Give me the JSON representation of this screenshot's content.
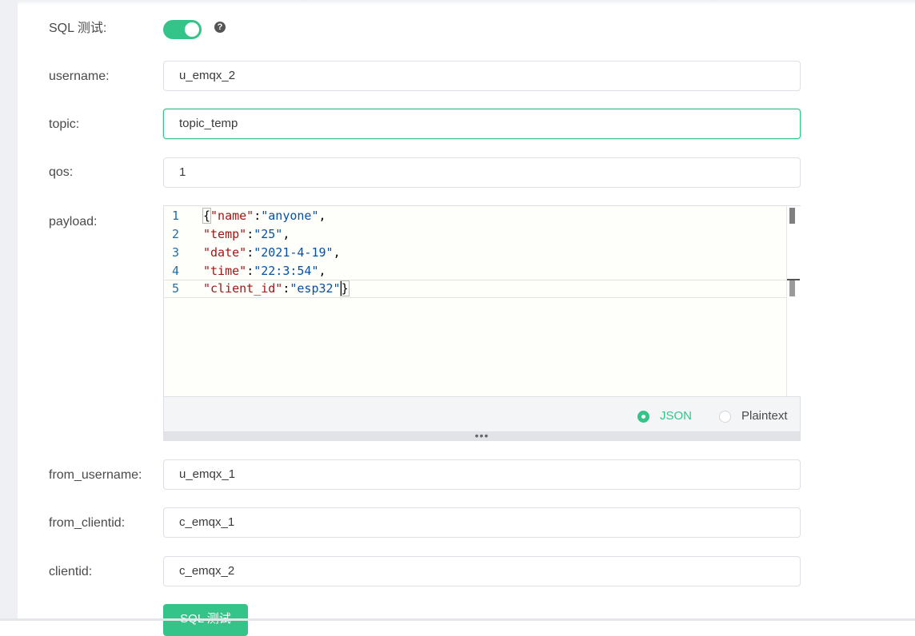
{
  "form": {
    "sql_test_label": "SQL 测试:",
    "sql_test_enabled": true,
    "help_icon": "question-circle-icon",
    "help_glyph": "?",
    "username": {
      "label": "username:",
      "value": "u_emqx_2"
    },
    "topic": {
      "label": "topic:",
      "value": "topic_temp"
    },
    "qos": {
      "label": "qos:",
      "value": "1"
    },
    "payload": {
      "label": "payload:",
      "line_numbers": [
        "1",
        "2",
        "3",
        "4",
        "5"
      ],
      "lines": [
        [
          {
            "t": "p",
            "v": "{"
          },
          {
            "t": "k",
            "v": "\"name\""
          },
          {
            "t": "p",
            "v": ":"
          },
          {
            "t": "s",
            "v": "\"anyone\""
          },
          {
            "t": "p",
            "v": ","
          }
        ],
        [
          {
            "t": "k",
            "v": "\"temp\""
          },
          {
            "t": "p",
            "v": ":"
          },
          {
            "t": "s",
            "v": "\"25\""
          },
          {
            "t": "p",
            "v": ","
          }
        ],
        [
          {
            "t": "k",
            "v": "\"date\""
          },
          {
            "t": "p",
            "v": ":"
          },
          {
            "t": "s",
            "v": "\"2021-4-19\""
          },
          {
            "t": "p",
            "v": ","
          }
        ],
        [
          {
            "t": "k",
            "v": "\"time\""
          },
          {
            "t": "p",
            "v": ":"
          },
          {
            "t": "s",
            "v": "\"22:3:54\""
          },
          {
            "t": "p",
            "v": ","
          }
        ],
        [
          {
            "t": "k",
            "v": "\"client_id\""
          },
          {
            "t": "p",
            "v": ":"
          },
          {
            "t": "s",
            "v": "\"esp32\""
          },
          {
            "t": "p",
            "v": "}"
          }
        ]
      ],
      "format_options": [
        "JSON",
        "Plaintext"
      ],
      "selected_format": "JSON",
      "resize_glyph": "•••"
    },
    "from_username": {
      "label": "from_username:",
      "value": "u_emqx_1"
    },
    "from_clientid": {
      "label": "from_clientid:",
      "value": "c_emqx_1"
    },
    "clientid": {
      "label": "clientid:",
      "value": "c_emqx_2"
    },
    "submit_label": "SQL 测试"
  },
  "colors": {
    "accent": "#34c388",
    "json_key": "#a31515",
    "json_string": "#0451a5",
    "line_number": "#1f6fa8"
  }
}
